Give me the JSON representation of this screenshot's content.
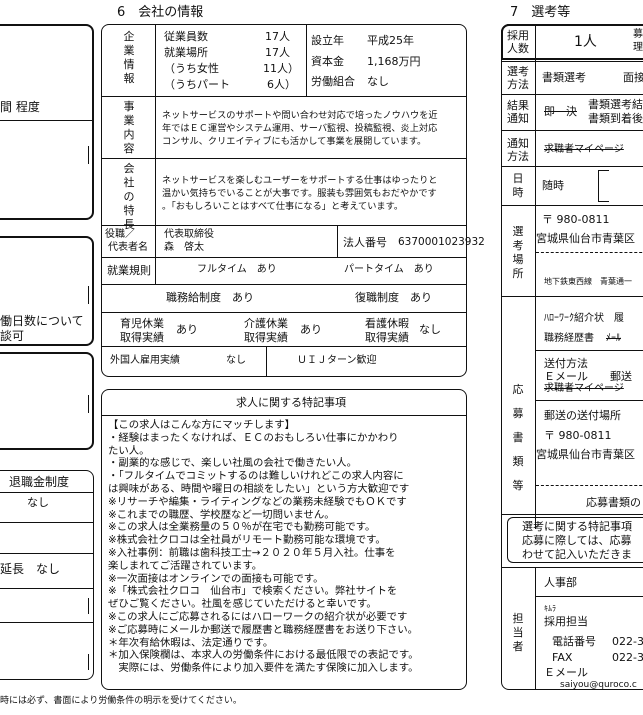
{
  "left_partial": {
    "degree_frag": "間 程度",
    "workdays_frag": [
      "働日数について",
      "談可"
    ],
    "retire": {
      "header": "退職金制度",
      "value": "なし",
      "extension": "延長　なし"
    },
    "footer_note": "時には必ず、書面により労働条件の明示を受けてください。"
  },
  "company": {
    "section_title": "6　会社の情報",
    "enterprise_label": "企業情報",
    "stats": [
      {
        "label": "従業員数",
        "value": "17人"
      },
      {
        "label": "就業場所",
        "value": "17人"
      },
      {
        "label": "（うち女性",
        "value": "11人）"
      },
      {
        "label": "（うちパート",
        "value": "6人）"
      }
    ],
    "founded_label": "設立年",
    "founded_value": "平成25年",
    "capital_label": "資本金",
    "capital_value": "1,168万円",
    "union_label": "労働組合",
    "union_value": "なし",
    "business_label": "事業内容",
    "business_text": [
      "ネットサービスのサポートや問い合わせ対応で培ったノウハウを近",
      "年ではＥＣ運営やシステム運用、サーバ監視、投稿監視、炎上対応",
      "コンサル、クリエイティブにも活かして事業を展開しています。"
    ],
    "features_label": "会社の特長",
    "features_text": [
      "ネットサービスを楽しむユーザーをサポートする仕事はゆったりと",
      "温かい気持ちでいることが大事です。服装も雰囲気もおだやかです",
      "。「おもしろいことはすべて仕事になる」と考えています。"
    ],
    "rep_label1": "役職／",
    "rep_label2": "代表者名",
    "rep_title": "代表取締役",
    "rep_name": "森　啓太",
    "corp_no_label": "法人番号",
    "corp_no": "6370001023932",
    "rules_label": "就業規則",
    "rules_full": "フルタイム　あり",
    "rules_part": "パートタイム　あり",
    "duties": "職務給制度　あり",
    "reinstate": "復職制度　あり",
    "childcare_label": [
      "育児休業",
      "取得実績"
    ],
    "childcare_value": "あり",
    "nursing_label": [
      "介護休業",
      "取得実績"
    ],
    "nursing_value": "あり",
    "sick_label": [
      "看護休暇",
      "取得実績"
    ],
    "sick_value": "なし",
    "foreign_label": "外国人雇用実績",
    "foreign_value": "なし",
    "uij": "ＵＩＪターン歓迎"
  },
  "special": {
    "title": "求人に関する特記事項",
    "lines": [
      "【この求人はこんな方にマッチします】",
      "・経験はまったくなければ、ＥＣのおもしろい仕事にかかわり",
      "たい人。",
      "・副業的な感じで、楽しい社風の会社で働きたい人。",
      "・「フルタイムでコミットするのは難しいけれどこの求人内容に",
      "は興味がある、時間や曜日の相談をしたい」という方大歓迎です",
      "※リサーチや編集・ライティングなどの業務未経験でもＯＫです",
      "※これまでの職歴、学校歴など一切問いません。",
      "※この求人は全業務量の５０％が在宅でも勤務可能です。",
      "※株式会社クロコは全社員がリモート勤務可能な環境です。",
      "※入社事例：前職は歯科技工士→２０２０年５月入社。仕事を",
      "楽しまれてご活躍されています。",
      "※一次面接はオンラインでの面接も可能です。",
      "※「株式会社クロコ　仙台市」で検索ください。弊社サイトを",
      "ぜひご覧ください。社風を感じていただけると幸いです。",
      "※この求人にご応募されるにはハローワークの紹介状が必要です",
      "※ご応募時にメールか郵送で履歴書と職務経歴書をお送り下さい。",
      "＊年次有給休暇は、法定通りです。",
      "＊加入保険欄は、本求人の労働条件における最低限での表記です。",
      "　実際には、労働条件により加入要件を満たす保険に加入します。"
    ]
  },
  "selection": {
    "section_title": "7　選考等",
    "hire_label": [
      "採用",
      "人数"
    ],
    "hire_value": "1人",
    "hire_frag": [
      "募",
      "理"
    ],
    "method_label": [
      "選考",
      "方法"
    ],
    "method_value": "書類選考",
    "method_value2": "面接",
    "result_label": [
      "結果",
      "通知"
    ],
    "result_strike": "即　決",
    "result_line1": "書類選考結",
    "result_line2": "書類到着後",
    "notice_label": [
      "通知",
      "方法"
    ],
    "notice_strike": "求職者マイページ",
    "date_label": "日時",
    "date_value": "随時",
    "place_label": "選考場所",
    "zip": "〒 980-0811",
    "address": "宮城県仙台市青葉区",
    "station": "地下鉄東西線　青葉通一",
    "apply_label": "応募書類等",
    "hw_doc": "ﾊﾛｰﾜｰｸ紹介状　履",
    "career_doc": "職務経歴書",
    "career_strike": "ﾒｰﾙ",
    "send_method": "送付方法",
    "email_post": "Ｅメール　　郵送",
    "mypage_strike": "求職者マイページ",
    "mail_dest": "郵送の送付場所",
    "zip2": "〒 980-0811",
    "address2": "宮城県仙台市青葉区",
    "apply_docs_caption": "応募書類の",
    "sp_lines": [
      "選考に関する特記事項",
      "応募に際しては、応募",
      "わせて記入いただきま"
    ],
    "contact_label": "担当者",
    "dept": "人事部",
    "kana": "ｷﾑﾗ",
    "person": "採用担当",
    "tel_label": "電話番号",
    "tel": "022-3",
    "fax_label": "FAX",
    "fax": "022-3",
    "email_label": "Ｅメール",
    "email": "saiyou@quroco.c"
  }
}
